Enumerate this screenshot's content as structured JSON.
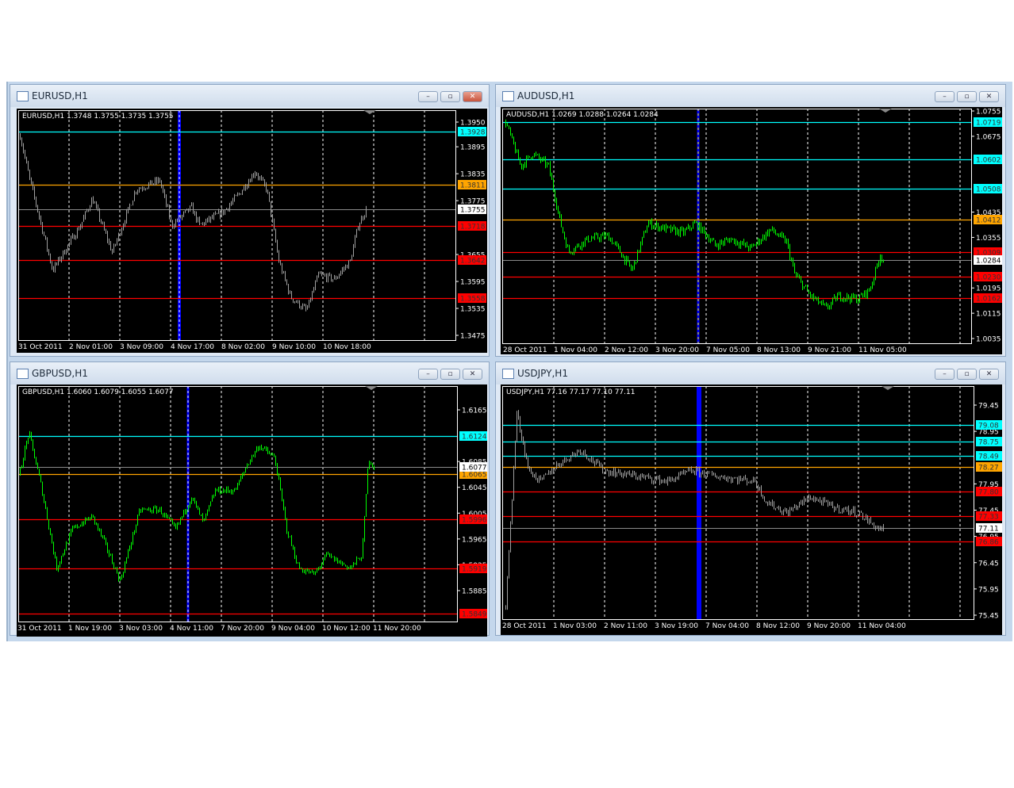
{
  "colors": {
    "support": "#ff0000",
    "resistance": "#00ffff",
    "pivot": "#ffa500",
    "current": "#ffffff",
    "vline": "#0000ff",
    "background": "#000000"
  },
  "windows": [
    {
      "title": "EURUSD,H1",
      "info": "EURUSD,H1  1.3748 1.3755 1.3735 1.3755",
      "bar_color": "#a0a0a0",
      "chart_data": {
        "type": "bar",
        "symbol": "EURUSD",
        "timeframe": "H1",
        "price_ticks": [
          "1.3950",
          "1.3895",
          "1.3835",
          "1.3775",
          "1.3655",
          "1.3595",
          "1.3535",
          "1.3475"
        ],
        "time_labels": [
          "31 Oct 2011",
          "2 Nov 01:00",
          "3 Nov 09:00",
          "4 Nov 17:00",
          "8 Nov 02:00",
          "9 Nov 10:00",
          "10 Nov 18:00"
        ],
        "levels": [
          {
            "price": "1.3928",
            "kind": "resistance"
          },
          {
            "price": "1.3811",
            "kind": "pivot"
          },
          {
            "price": "1.3718",
            "kind": "support"
          },
          {
            "price": "1.3642",
            "kind": "support"
          },
          {
            "price": "1.3558",
            "kind": "support"
          }
        ],
        "current": "1.3755",
        "close_path": [
          1.392,
          1.383,
          1.362,
          1.372,
          1.378,
          1.366,
          1.38,
          1.382,
          1.372,
          1.376,
          1.372,
          1.375,
          1.379,
          1.384,
          1.38,
          1.364,
          1.356,
          1.353,
          1.361,
          1.36,
          1.364,
          1.372,
          1.3755
        ]
      }
    },
    {
      "title": "AUDUSD,H1",
      "info": "AUDUSD,H1  1.0269 1.0288 1.0264 1.0284",
      "bar_color": "#00ff00",
      "chart_data": {
        "type": "bar",
        "symbol": "AUDUSD",
        "timeframe": "H1",
        "price_ticks": [
          "1.0755",
          "1.0675",
          "1.0435",
          "1.0355",
          "1.0195",
          "1.0115",
          "1.0035"
        ],
        "time_labels": [
          "28 Oct 2011",
          "1 Nov 04:00",
          "2 Nov 12:00",
          "3 Nov 20:00",
          "7 Nov 05:00",
          "8 Nov 13:00",
          "9 Nov 21:00",
          "11 Nov 05:00"
        ],
        "levels": [
          {
            "price": "1.0719",
            "kind": "resistance"
          },
          {
            "price": "1.0602",
            "kind": "resistance"
          },
          {
            "price": "1.0508",
            "kind": "resistance"
          },
          {
            "price": "1.0412",
            "kind": "pivot"
          },
          {
            "price": "1.0309",
            "kind": "support"
          },
          {
            "price": "1.0230",
            "kind": "support"
          },
          {
            "price": "1.0162",
            "kind": "support"
          }
        ],
        "current": "1.0284",
        "close_path": [
          1.072,
          1.058,
          1.062,
          1.058,
          1.04,
          1.031,
          1.035,
          1.036,
          1.031,
          1.025,
          1.04,
          1.038,
          1.037,
          1.04,
          1.036,
          1.033,
          1.035,
          1.032,
          1.038,
          1.034,
          1.024,
          1.017,
          1.013,
          1.017,
          1.016,
          1.019,
          1.03,
          1.0284
        ]
      }
    },
    {
      "title": "GBPUSD,H1",
      "info": "GBPUSD,H1  1.6060 1.6079 1.6055 1.6077",
      "bar_color": "#00ff00",
      "chart_data": {
        "type": "bar",
        "symbol": "GBPUSD",
        "timeframe": "H1",
        "price_ticks": [
          "1.6165",
          "1.6085",
          "1.6045",
          "1.6005",
          "1.5965",
          "1.5925",
          "1.5885"
        ],
        "time_labels": [
          "31 Oct 2011",
          "1 Nov 19:00",
          "3 Nov 03:00",
          "4 Nov 11:00",
          "7 Nov 20:00",
          "9 Nov 04:00",
          "10 Nov 12:00",
          "11 Nov 20:00"
        ],
        "levels": [
          {
            "price": "1.6124",
            "kind": "resistance"
          },
          {
            "price": "1.6065",
            "kind": "pivot"
          },
          {
            "price": "1.5996",
            "kind": "support"
          },
          {
            "price": "1.5919",
            "kind": "support"
          },
          {
            "price": "1.5849",
            "kind": "support"
          }
        ],
        "current": "1.6077",
        "close_path": [
          1.606,
          1.613,
          1.605,
          1.592,
          1.598,
          1.6,
          1.596,
          1.59,
          1.601,
          1.601,
          1.598,
          1.603,
          1.599,
          1.604,
          1.604,
          1.608,
          1.611,
          1.609,
          1.598,
          1.592,
          1.591,
          1.594,
          1.592,
          1.594,
          1.609,
          1.6077
        ]
      }
    },
    {
      "title": "USDJPY,H1",
      "info": "USDJPY,H1  77.16 77.17 77.10 77.11",
      "bar_color": "#a0a0a0",
      "chart_data": {
        "type": "bar",
        "symbol": "USDJPY",
        "timeframe": "H1",
        "price_ticks": [
          "79.45",
          "78.95",
          "77.95",
          "77.45",
          "76.95",
          "76.45",
          "75.95",
          "75.45"
        ],
        "time_labels": [
          "28 Oct 2011",
          "1 Nov 03:00",
          "2 Nov 11:00",
          "3 Nov 19:00",
          "7 Nov 04:00",
          "8 Nov 12:00",
          "9 Nov 20:00",
          "11 Nov 04:00"
        ],
        "levels": [
          {
            "price": "79.08",
            "kind": "resistance"
          },
          {
            "price": "78.75",
            "kind": "resistance"
          },
          {
            "price": "78.49",
            "kind": "resistance"
          },
          {
            "price": "78.27",
            "kind": "pivot"
          },
          {
            "price": "77.80",
            "kind": "support"
          },
          {
            "price": "77.33",
            "kind": "support"
          },
          {
            "price": "76.86",
            "kind": "support"
          }
        ],
        "current": "77.11",
        "close_path": [
          75.6,
          79.3,
          78.2,
          78.0,
          78.3,
          78.6,
          78.2,
          78.1,
          78.0,
          78.2,
          78.1,
          78.0,
          77.6,
          77.4,
          77.7,
          77.5,
          77.4,
          77.1,
          77.11
        ]
      }
    }
  ],
  "window_buttons": {
    "minimize": "–",
    "restore": "▫",
    "close": "✕"
  }
}
